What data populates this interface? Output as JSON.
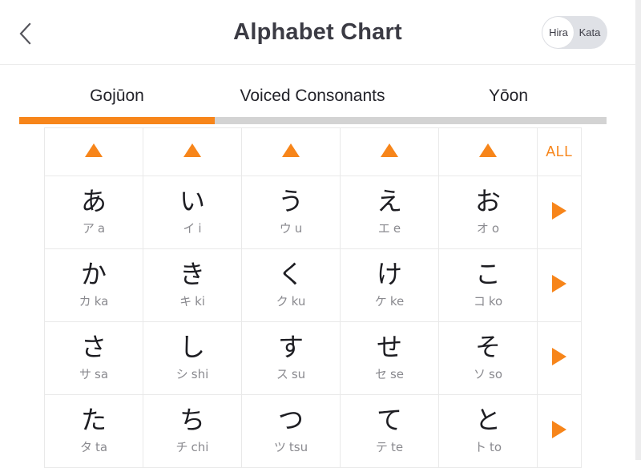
{
  "header": {
    "title": "Alphabet Chart",
    "back_icon": "chevron-left-icon",
    "toggle": {
      "left_label": "Hira",
      "right_label": "Kata",
      "selected": "Hira"
    }
  },
  "tabs": {
    "items": [
      {
        "label": "Gojūon",
        "active": true
      },
      {
        "label": "Voiced Consonants",
        "active": false
      },
      {
        "label": "Yōon",
        "active": false
      }
    ],
    "indicator_color": "#f7851a",
    "track_color": "#d3d3d3"
  },
  "chart": {
    "accent_color": "#f7851a",
    "header_row": {
      "column_play_icon": "triangle-up-icon",
      "all_label": "ALL"
    },
    "row_play_icon": "triangle-right-icon",
    "rows": [
      {
        "cells": [
          {
            "kana": "あ",
            "kata": "ア",
            "romaji": "a"
          },
          {
            "kana": "い",
            "kata": "イ",
            "romaji": "i"
          },
          {
            "kana": "う",
            "kata": "ウ",
            "romaji": "u"
          },
          {
            "kana": "え",
            "kata": "エ",
            "romaji": "e"
          },
          {
            "kana": "お",
            "kata": "オ",
            "romaji": "o"
          }
        ]
      },
      {
        "cells": [
          {
            "kana": "か",
            "kata": "カ",
            "romaji": "ka"
          },
          {
            "kana": "き",
            "kata": "キ",
            "romaji": "ki"
          },
          {
            "kana": "く",
            "kata": "ク",
            "romaji": "ku"
          },
          {
            "kana": "け",
            "kata": "ケ",
            "romaji": "ke"
          },
          {
            "kana": "こ",
            "kata": "コ",
            "romaji": "ko"
          }
        ]
      },
      {
        "cells": [
          {
            "kana": "さ",
            "kata": "サ",
            "romaji": "sa"
          },
          {
            "kana": "し",
            "kata": "シ",
            "romaji": "shi"
          },
          {
            "kana": "す",
            "kata": "ス",
            "romaji": "su"
          },
          {
            "kana": "せ",
            "kata": "セ",
            "romaji": "se"
          },
          {
            "kana": "そ",
            "kata": "ソ",
            "romaji": "so"
          }
        ]
      },
      {
        "cells": [
          {
            "kana": "た",
            "kata": "タ",
            "romaji": "ta"
          },
          {
            "kana": "ち",
            "kata": "チ",
            "romaji": "chi"
          },
          {
            "kana": "つ",
            "kata": "ツ",
            "romaji": "tsu"
          },
          {
            "kana": "て",
            "kata": "テ",
            "romaji": "te"
          },
          {
            "kana": "と",
            "kata": "ト",
            "romaji": "to"
          }
        ]
      }
    ]
  }
}
